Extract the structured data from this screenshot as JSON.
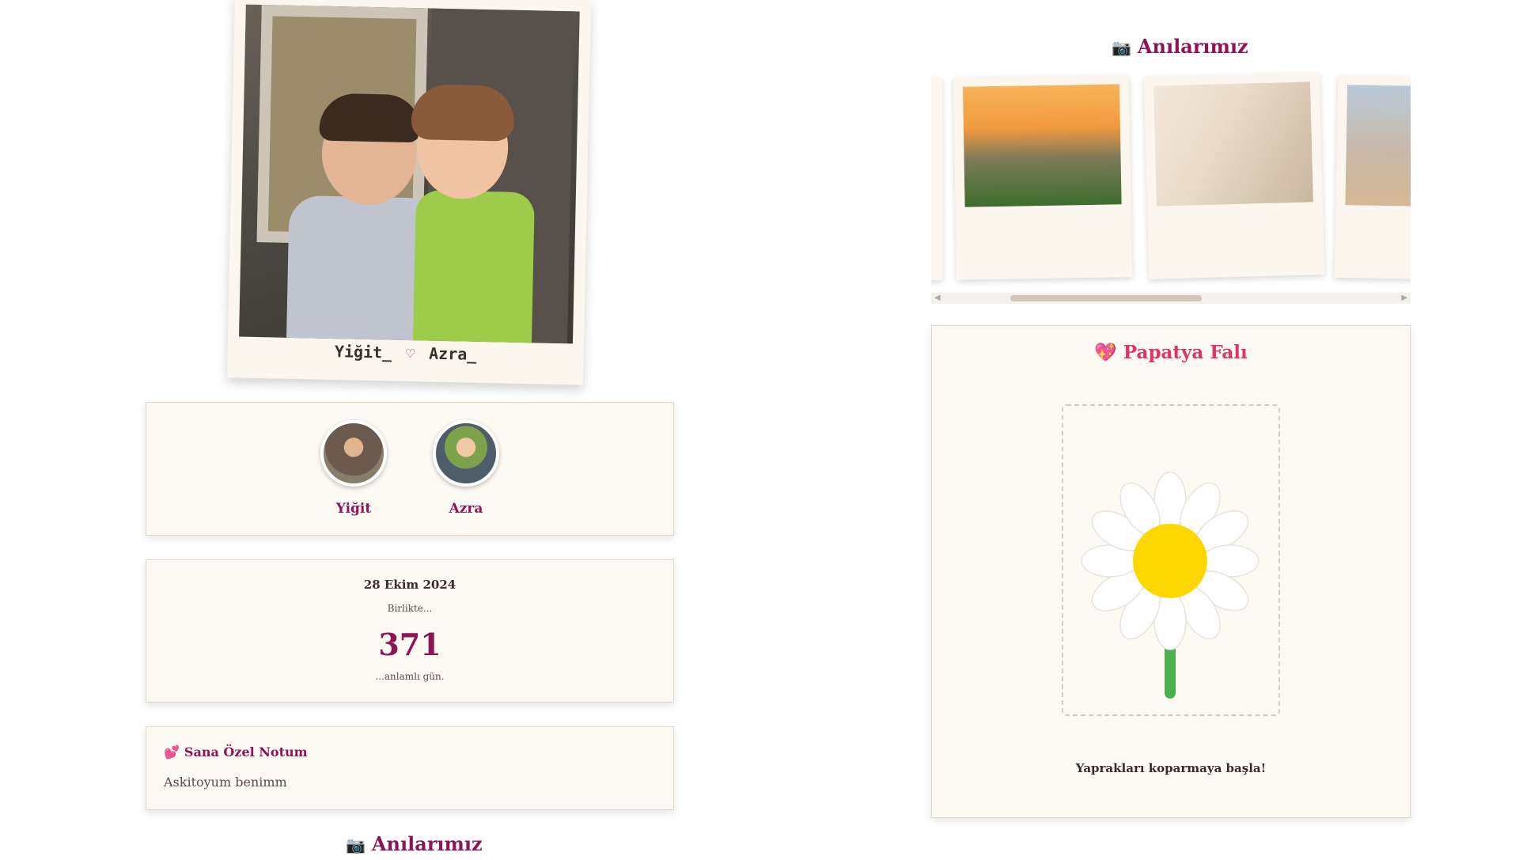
{
  "polaroid": {
    "caption_left": "Yiğit_",
    "caption_right": "Azra_"
  },
  "people": [
    {
      "name": "Yiğit"
    },
    {
      "name": "Azra"
    }
  ],
  "date_card": {
    "date": "28 Ekim 2024",
    "together": "Birlikte...",
    "days": "371",
    "meaningful": "...anlamlı gün."
  },
  "note": {
    "title": "Sana Özel Notum",
    "body": "Askitoyum benimm"
  },
  "memories": {
    "title": "Anılarımız"
  },
  "fortune": {
    "title": "Papatya Falı",
    "prompt": "Yaprakları koparmaya başla!"
  },
  "colors": {
    "accent": "#8e1456",
    "heart_pink": "#e0336b",
    "card_bg": "#fdfaf4",
    "daisy_center": "#ffd700",
    "stem": "#4caf50"
  },
  "icons": {
    "camera": "camera-icon",
    "heart": "heart-icon",
    "hearts": "two-hearts-icon",
    "heart_pulse": "growing-heart-icon"
  }
}
